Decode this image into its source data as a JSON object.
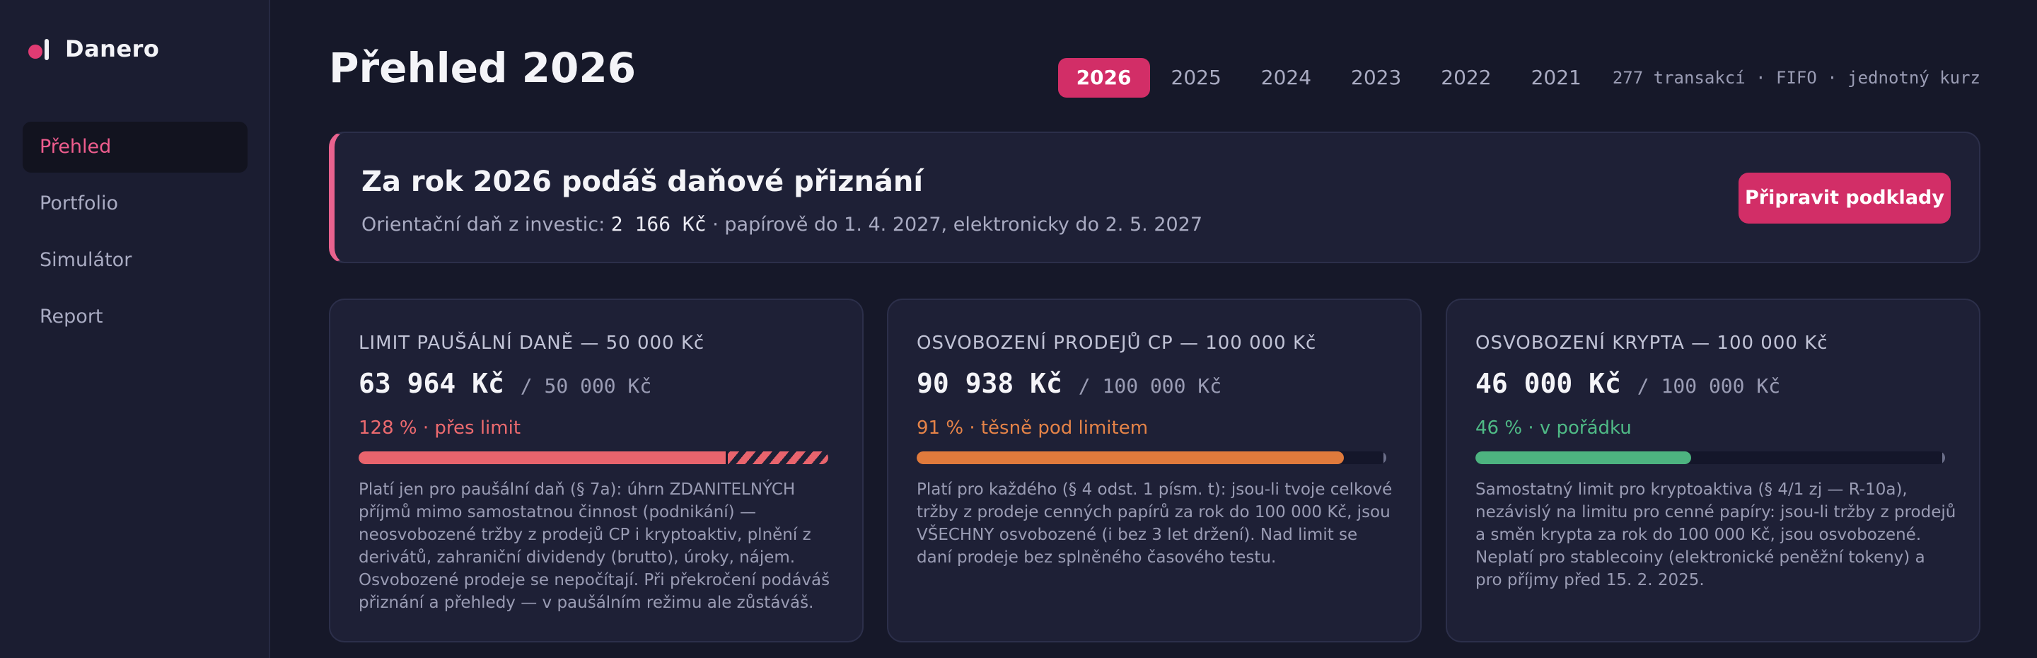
{
  "app": {
    "name": "Danero"
  },
  "nav": {
    "items": [
      {
        "label": "Přehled",
        "active": true
      },
      {
        "label": "Portfolio",
        "active": false
      },
      {
        "label": "Simulátor",
        "active": false
      },
      {
        "label": "Report",
        "active": false
      }
    ]
  },
  "header": {
    "title": "Přehled 2026",
    "years": [
      "2026",
      "2025",
      "2024",
      "2023",
      "2022",
      "2021"
    ],
    "selected_year": "2026",
    "meta": "277 transakcí · FIFO · jednotný kurz"
  },
  "banner": {
    "title": "Za rok 2026 podáš daňové přiznání",
    "sub_prefix": "Orientační daň z investic:",
    "amount": "2 166 Kč",
    "sub_suffix": "· papírově do 1. 4. 2027, elektronicky do 2. 5. 2027",
    "button": "Připravit podklady"
  },
  "cards": [
    {
      "title": "LIMIT PAUŠÁLNÍ DANĚ — 50 000 Kč",
      "value": "63 964 Kč",
      "limit": "/ 50 000 Kč",
      "status": "128 % · přes limit",
      "status_color": "#ec6a6f",
      "fill_color": "#e9646d",
      "ratio": 1.28,
      "description": "Platí jen pro paušální daň (§ 7a): úhrn ZDANITELNÝCH příjmů mimo samostatnou činnost (podnikání) — neosvobozené tržby z prodejů CP i kryptoaktiv, plnění z derivátů, zahraniční dividendy (brutto), úroky, nájem. Osvobozené prodeje se nepočítají. Při překročení podáváš přiznání a přehledy — v paušálním režimu ale zůstáváš."
    },
    {
      "title": "OSVOBOZENÍ PRODEJŮ CP — 100 000 Kč",
      "value": "90 938 Kč",
      "limit": "/ 100 000 Kč",
      "status": "91 % · těsně pod limitem",
      "status_color": "#e58348",
      "fill_color": "#e07a3c",
      "ratio": 0.91,
      "description": "Platí pro každého (§ 4 odst. 1 písm. t): jsou-li tvoje celkové tržby z prodeje cenných papírů za rok do 100 000 Kč, jsou VŠECHNY osvobozené (i bez 3 let držení). Nad limit se daní prodeje bez splněného časového testu."
    },
    {
      "title": "OSVOBOZENÍ KRYPTA — 100 000 Kč",
      "value": "46 000 Kč",
      "limit": "/ 100 000 Kč",
      "status": "46 % · v pořádku",
      "status_color": "#4fba86",
      "fill_color": "#4db380",
      "ratio": 0.46,
      "description": "Samostatný limit pro kryptoaktiva (§ 4/1 zj — R-10a), nezávislý na limitu pro cenné papíry: jsou-li tržby z prodejů a směn krypta za rok do 100 000 Kč, jsou osvobozené. Neplatí pro stablecoiny (elektronické peněžní tokeny) a pro příjmy před 15. 2. 2025."
    }
  ]
}
